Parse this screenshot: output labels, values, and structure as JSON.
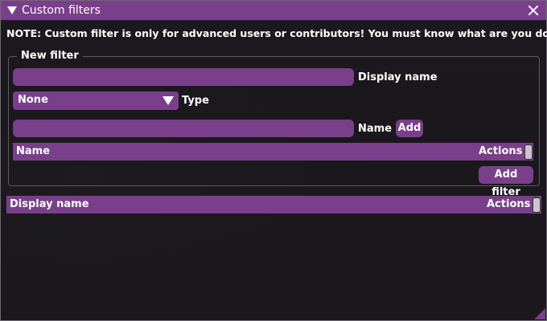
{
  "window": {
    "title": "Custom filters",
    "accent_color": "#7a3f8a",
    "collapse_icon": "triangle-down-icon",
    "close_icon": "close-icon"
  },
  "note": "NOTE: Custom filter is only for advanced users or contributors! You must know what are you doing.",
  "new_filter": {
    "legend": "New filter",
    "display_name": {
      "value": "",
      "label": "Display name"
    },
    "type": {
      "selected": "None",
      "label": "Type"
    },
    "name": {
      "value": "",
      "label": "Name"
    },
    "add_button": "Add",
    "table": {
      "columns": [
        "Name",
        "Actions"
      ],
      "rows": []
    },
    "add_filter_button": "Add filter"
  },
  "filters_table": {
    "columns": [
      "Display name",
      "Actions"
    ],
    "rows": []
  }
}
